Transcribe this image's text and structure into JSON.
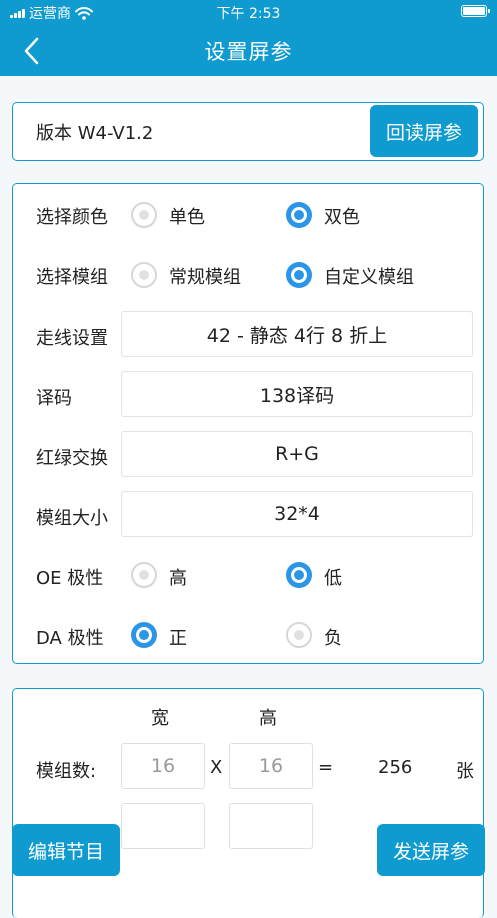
{
  "status": {
    "carrier": "运营商",
    "time": "下午 2:53"
  },
  "nav": {
    "title": "设置屏参"
  },
  "version": {
    "label": "版本  W4-V1.2",
    "readback_button": "回读屏参"
  },
  "settings": {
    "color": {
      "label": "选择颜色",
      "opt1": "单色",
      "opt2": "双色",
      "selected": 2
    },
    "module": {
      "label": "选择模组",
      "opt1": "常规模组",
      "opt2": "自定义模组",
      "selected": 2
    },
    "routing": {
      "label": "走线设置",
      "value": "42 - 静态 4行 8 折上"
    },
    "decode": {
      "label": "译码",
      "value": "138译码"
    },
    "rg_swap": {
      "label": "红绿交换",
      "value": "R+G"
    },
    "module_size": {
      "label": "模组大小",
      "value": "32*4"
    },
    "oe": {
      "label": "OE 极性",
      "opt1": "高",
      "opt2": "低",
      "selected": 2
    },
    "da": {
      "label": "DA 极性",
      "opt1": "正",
      "opt2": "负",
      "selected": 1
    }
  },
  "dimensions": {
    "width_header": "宽",
    "height_header": "高",
    "count_label": "模组数:",
    "width_value": "16",
    "times": "X",
    "height_value": "16",
    "equals": "=",
    "total": "256",
    "unit": "张"
  },
  "footer": {
    "edit_button": "编辑节目",
    "send_button": "发送屏参"
  },
  "colors": {
    "primary": "#0f9bd0",
    "radio_selected": "#2b95e8"
  }
}
